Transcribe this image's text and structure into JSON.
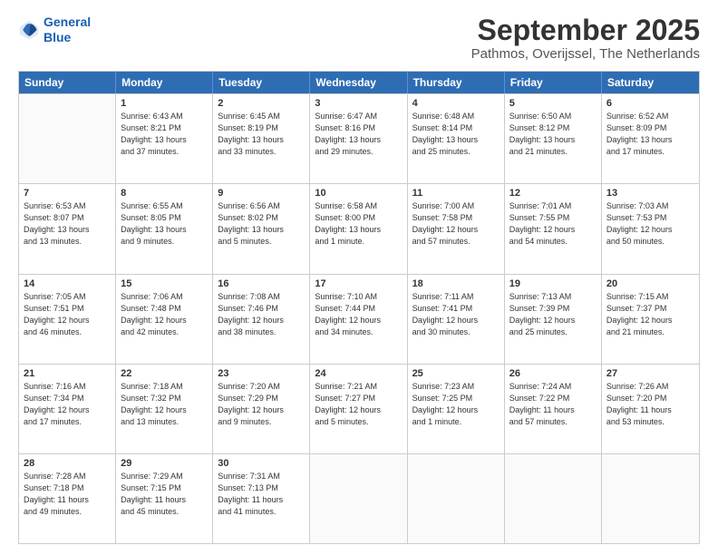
{
  "logo": {
    "line1": "General",
    "line2": "Blue"
  },
  "title": "September 2025",
  "subtitle": "Pathmos, Overijssel, The Netherlands",
  "header_days": [
    "Sunday",
    "Monday",
    "Tuesday",
    "Wednesday",
    "Thursday",
    "Friday",
    "Saturday"
  ],
  "weeks": [
    [
      {
        "day": "",
        "info": ""
      },
      {
        "day": "1",
        "info": "Sunrise: 6:43 AM\nSunset: 8:21 PM\nDaylight: 13 hours\nand 37 minutes."
      },
      {
        "day": "2",
        "info": "Sunrise: 6:45 AM\nSunset: 8:19 PM\nDaylight: 13 hours\nand 33 minutes."
      },
      {
        "day": "3",
        "info": "Sunrise: 6:47 AM\nSunset: 8:16 PM\nDaylight: 13 hours\nand 29 minutes."
      },
      {
        "day": "4",
        "info": "Sunrise: 6:48 AM\nSunset: 8:14 PM\nDaylight: 13 hours\nand 25 minutes."
      },
      {
        "day": "5",
        "info": "Sunrise: 6:50 AM\nSunset: 8:12 PM\nDaylight: 13 hours\nand 21 minutes."
      },
      {
        "day": "6",
        "info": "Sunrise: 6:52 AM\nSunset: 8:09 PM\nDaylight: 13 hours\nand 17 minutes."
      }
    ],
    [
      {
        "day": "7",
        "info": "Sunrise: 6:53 AM\nSunset: 8:07 PM\nDaylight: 13 hours\nand 13 minutes."
      },
      {
        "day": "8",
        "info": "Sunrise: 6:55 AM\nSunset: 8:05 PM\nDaylight: 13 hours\nand 9 minutes."
      },
      {
        "day": "9",
        "info": "Sunrise: 6:56 AM\nSunset: 8:02 PM\nDaylight: 13 hours\nand 5 minutes."
      },
      {
        "day": "10",
        "info": "Sunrise: 6:58 AM\nSunset: 8:00 PM\nDaylight: 13 hours\nand 1 minute."
      },
      {
        "day": "11",
        "info": "Sunrise: 7:00 AM\nSunset: 7:58 PM\nDaylight: 12 hours\nand 57 minutes."
      },
      {
        "day": "12",
        "info": "Sunrise: 7:01 AM\nSunset: 7:55 PM\nDaylight: 12 hours\nand 54 minutes."
      },
      {
        "day": "13",
        "info": "Sunrise: 7:03 AM\nSunset: 7:53 PM\nDaylight: 12 hours\nand 50 minutes."
      }
    ],
    [
      {
        "day": "14",
        "info": "Sunrise: 7:05 AM\nSunset: 7:51 PM\nDaylight: 12 hours\nand 46 minutes."
      },
      {
        "day": "15",
        "info": "Sunrise: 7:06 AM\nSunset: 7:48 PM\nDaylight: 12 hours\nand 42 minutes."
      },
      {
        "day": "16",
        "info": "Sunrise: 7:08 AM\nSunset: 7:46 PM\nDaylight: 12 hours\nand 38 minutes."
      },
      {
        "day": "17",
        "info": "Sunrise: 7:10 AM\nSunset: 7:44 PM\nDaylight: 12 hours\nand 34 minutes."
      },
      {
        "day": "18",
        "info": "Sunrise: 7:11 AM\nSunset: 7:41 PM\nDaylight: 12 hours\nand 30 minutes."
      },
      {
        "day": "19",
        "info": "Sunrise: 7:13 AM\nSunset: 7:39 PM\nDaylight: 12 hours\nand 25 minutes."
      },
      {
        "day": "20",
        "info": "Sunrise: 7:15 AM\nSunset: 7:37 PM\nDaylight: 12 hours\nand 21 minutes."
      }
    ],
    [
      {
        "day": "21",
        "info": "Sunrise: 7:16 AM\nSunset: 7:34 PM\nDaylight: 12 hours\nand 17 minutes."
      },
      {
        "day": "22",
        "info": "Sunrise: 7:18 AM\nSunset: 7:32 PM\nDaylight: 12 hours\nand 13 minutes."
      },
      {
        "day": "23",
        "info": "Sunrise: 7:20 AM\nSunset: 7:29 PM\nDaylight: 12 hours\nand 9 minutes."
      },
      {
        "day": "24",
        "info": "Sunrise: 7:21 AM\nSunset: 7:27 PM\nDaylight: 12 hours\nand 5 minutes."
      },
      {
        "day": "25",
        "info": "Sunrise: 7:23 AM\nSunset: 7:25 PM\nDaylight: 12 hours\nand 1 minute."
      },
      {
        "day": "26",
        "info": "Sunrise: 7:24 AM\nSunset: 7:22 PM\nDaylight: 11 hours\nand 57 minutes."
      },
      {
        "day": "27",
        "info": "Sunrise: 7:26 AM\nSunset: 7:20 PM\nDaylight: 11 hours\nand 53 minutes."
      }
    ],
    [
      {
        "day": "28",
        "info": "Sunrise: 7:28 AM\nSunset: 7:18 PM\nDaylight: 11 hours\nand 49 minutes."
      },
      {
        "day": "29",
        "info": "Sunrise: 7:29 AM\nSunset: 7:15 PM\nDaylight: 11 hours\nand 45 minutes."
      },
      {
        "day": "30",
        "info": "Sunrise: 7:31 AM\nSunset: 7:13 PM\nDaylight: 11 hours\nand 41 minutes."
      },
      {
        "day": "",
        "info": ""
      },
      {
        "day": "",
        "info": ""
      },
      {
        "day": "",
        "info": ""
      },
      {
        "day": "",
        "info": ""
      }
    ]
  ]
}
